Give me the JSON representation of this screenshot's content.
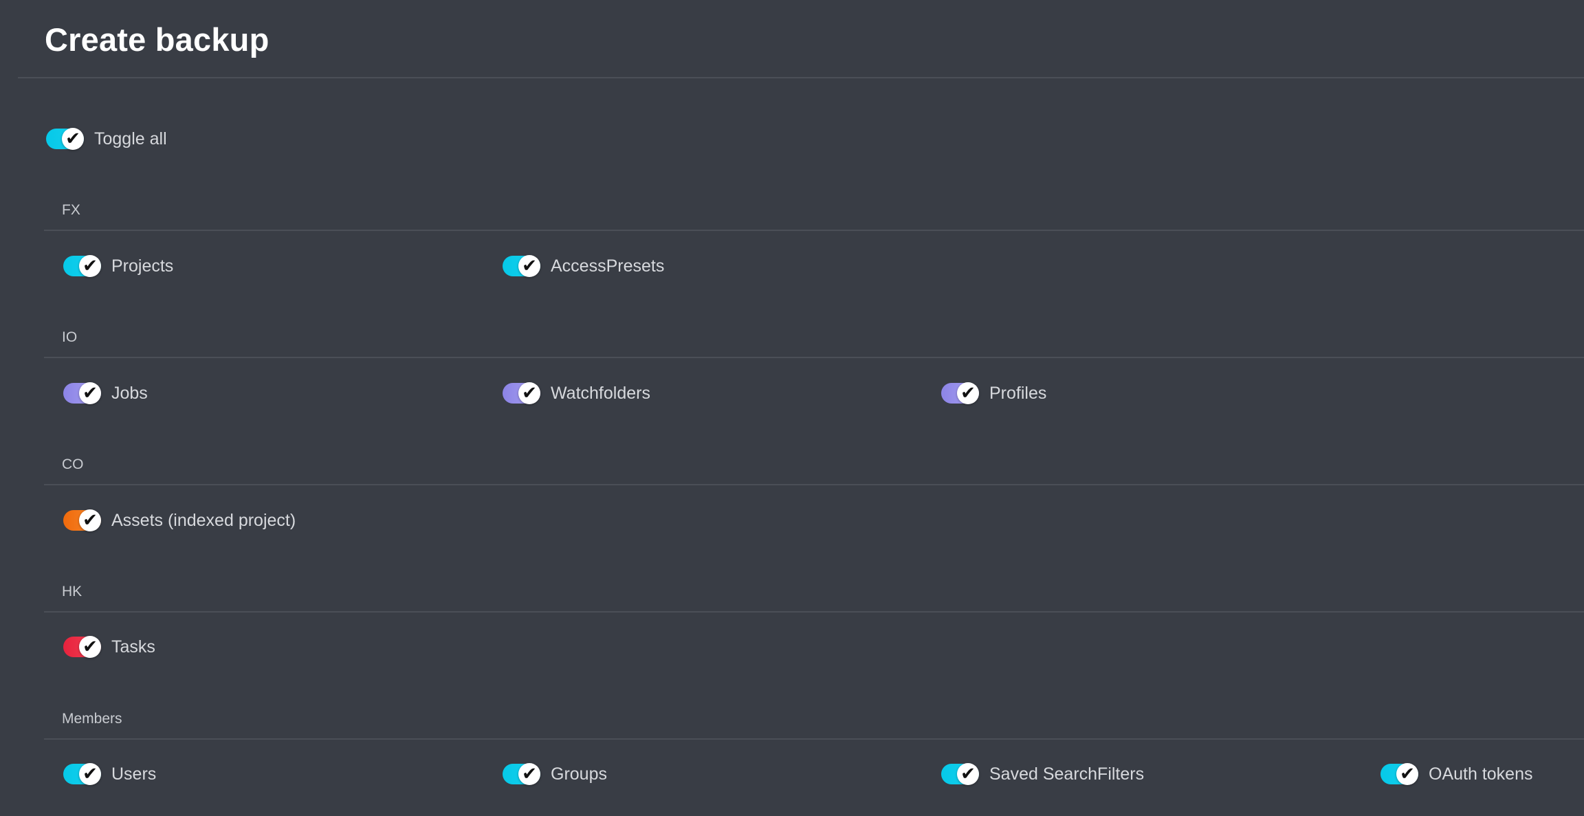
{
  "page": {
    "title": "Create backup"
  },
  "toggle_all": {
    "label": "Toggle all",
    "checked": true,
    "color": "#06c9e8"
  },
  "sections": [
    {
      "title": "FX",
      "color": "#06c9e8",
      "items": [
        {
          "label": "Projects",
          "checked": true
        },
        {
          "label": "AccessPresets",
          "checked": true
        }
      ]
    },
    {
      "title": "IO",
      "color": "#8c84e6",
      "items": [
        {
          "label": "Jobs",
          "checked": true
        },
        {
          "label": "Watchfolders",
          "checked": true
        },
        {
          "label": "Profiles",
          "checked": true
        }
      ]
    },
    {
      "title": "CO",
      "color": "#f06a0c",
      "items": [
        {
          "label": "Assets (indexed project)",
          "checked": true
        }
      ]
    },
    {
      "title": "HK",
      "color": "#e8223d",
      "items": [
        {
          "label": "Tasks",
          "checked": true
        }
      ]
    },
    {
      "title": "Members",
      "color": "#06c9e8",
      "items": [
        {
          "label": "Users",
          "checked": true
        },
        {
          "label": "Groups",
          "checked": true
        },
        {
          "label": "Saved SearchFilters",
          "checked": true
        },
        {
          "label": "OAuth tokens",
          "checked": true
        }
      ]
    }
  ],
  "icons": {
    "toggle_thumb": "check-icon",
    "check_glyph": "✔"
  }
}
